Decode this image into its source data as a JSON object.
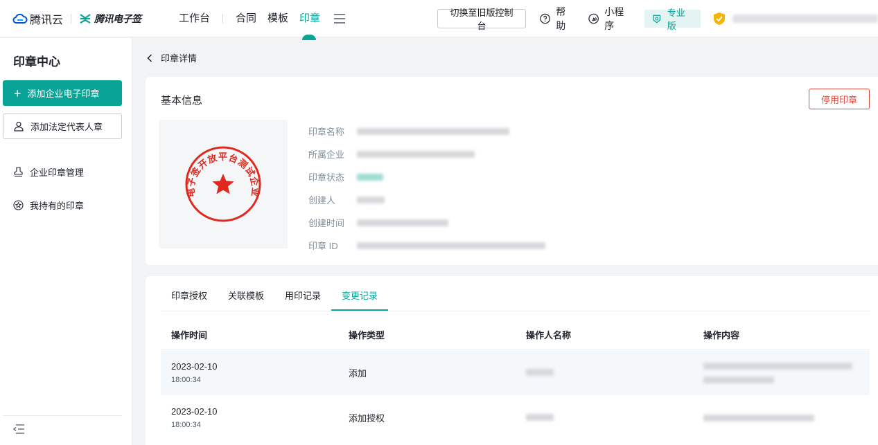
{
  "brand": {
    "name": "腾讯云",
    "product": "腾讯电子签"
  },
  "nav": {
    "items": [
      "工作台",
      "合同",
      "模板",
      "印章"
    ],
    "active": "印章"
  },
  "topbar": {
    "switch_label": "切换至旧版控制台",
    "help_label": "帮助",
    "miniapp_label": "小程序",
    "pro_label": "专业版"
  },
  "sidebar": {
    "title": "印章中心",
    "add_company_seal": "添加企业电子印章",
    "add_legal_seal": "添加法定代表人章",
    "items": [
      {
        "label": "企业印章管理"
      },
      {
        "label": "我持有的印章"
      }
    ]
  },
  "breadcrumb": {
    "label": "印章详情"
  },
  "basic_info": {
    "title": "基本信息",
    "disable_button": "停用印章",
    "seal_text": "电子签开放平台测试企业",
    "fields": [
      {
        "label": "印章名称"
      },
      {
        "label": "所属企业"
      },
      {
        "label": "印章状态"
      },
      {
        "label": "创建人"
      },
      {
        "label": "创建时间"
      },
      {
        "label": "印章 ID"
      }
    ]
  },
  "tabs": [
    "印章授权",
    "关联模板",
    "用印记录",
    "变更记录"
  ],
  "active_tab": "变更记录",
  "table": {
    "headers": [
      "操作时间",
      "操作类型",
      "操作人名称",
      "操作内容"
    ],
    "rows": [
      {
        "date": "2023-02-10",
        "time": "18:00:34",
        "type": "添加"
      },
      {
        "date": "2023-02-10",
        "time": "18:00:34",
        "type": "添加授权"
      }
    ]
  },
  "colors": {
    "accent": "#0aa496",
    "danger": "#e0483d",
    "seal_red": "#e0281e"
  }
}
